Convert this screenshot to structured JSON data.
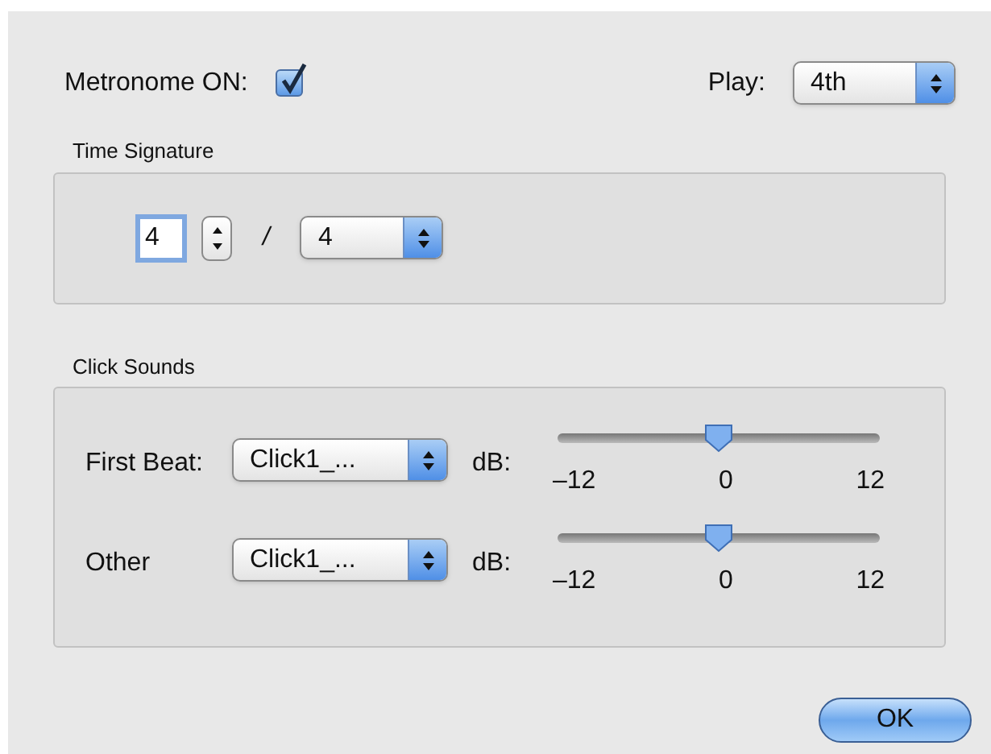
{
  "metronome": {
    "label": "Metronome ON:",
    "checked": true
  },
  "play": {
    "label": "Play:",
    "value": "4th"
  },
  "time_signature": {
    "title": "Time Signature",
    "beats": "4",
    "divider": "/",
    "unit": "4"
  },
  "click_sounds": {
    "title": "Click Sounds",
    "rows": [
      {
        "label": "First Beat:",
        "sound": "Click1_...",
        "db_label": "dB:",
        "level": 0.5,
        "ticks": [
          "–12",
          "0",
          "12"
        ]
      },
      {
        "label": "Other",
        "sound": "Click1_...",
        "db_label": "dB:",
        "level": 0.5,
        "ticks": [
          "–12",
          "0",
          "12"
        ]
      }
    ]
  },
  "buttons": [
    {
      "label": "OK"
    }
  ]
}
